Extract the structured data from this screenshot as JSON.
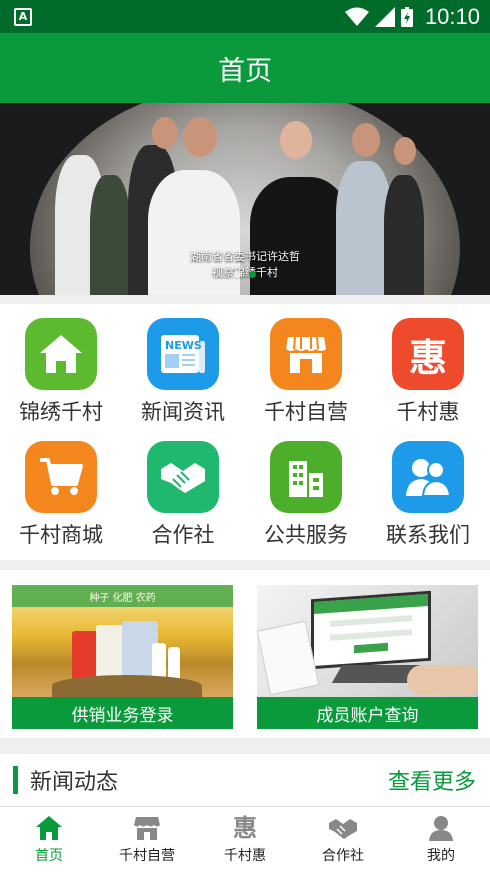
{
  "status_bar": {
    "time": "10:10",
    "notification_icon": "A"
  },
  "app_bar": {
    "title": "首页"
  },
  "banner": {
    "caption_line1": "湖南省省委书记许达哲",
    "caption_line2": "视察锦绣千村",
    "slide_count": 2,
    "active_slide": 2
  },
  "menu": {
    "items": [
      {
        "label": "锦绣千村",
        "icon": "home-icon",
        "color": "#5cba2f"
      },
      {
        "label": "新闻资讯",
        "icon": "newspaper-icon",
        "color": "#1d9ae8"
      },
      {
        "label": "千村自营",
        "icon": "shop-icon",
        "color": "#f3861d"
      },
      {
        "label": "千村惠",
        "icon": "hui-icon",
        "color": "#ee4a2c",
        "glyph": "惠"
      },
      {
        "label": "千村商城",
        "icon": "cart-icon",
        "color": "#f3861d"
      },
      {
        "label": "合作社",
        "icon": "handshake-icon",
        "color": "#1fb86e"
      },
      {
        "label": "公共服务",
        "icon": "building-icon",
        "color": "#4cae2b"
      },
      {
        "label": "联系我们",
        "icon": "contacts-icon",
        "color": "#1d9ae8"
      }
    ]
  },
  "promos": {
    "left": {
      "label": "供销业务登录",
      "overlay_text": "种子 化肥 农药"
    },
    "right": {
      "label": "成员账户查询"
    }
  },
  "news": {
    "title": "新闻动态",
    "more": "查看更多"
  },
  "tabbar": {
    "items": [
      {
        "label": "首页",
        "icon": "home-icon",
        "active": true
      },
      {
        "label": "千村自营",
        "icon": "shop-icon",
        "active": false
      },
      {
        "label": "千村惠",
        "icon": "hui-icon",
        "active": false,
        "glyph": "惠"
      },
      {
        "label": "合作社",
        "icon": "handshake-icon",
        "active": false
      },
      {
        "label": "我的",
        "icon": "person-icon",
        "active": false
      }
    ]
  },
  "colors": {
    "brand_green": "#0b9a3b",
    "status_bar": "#006b2b"
  }
}
